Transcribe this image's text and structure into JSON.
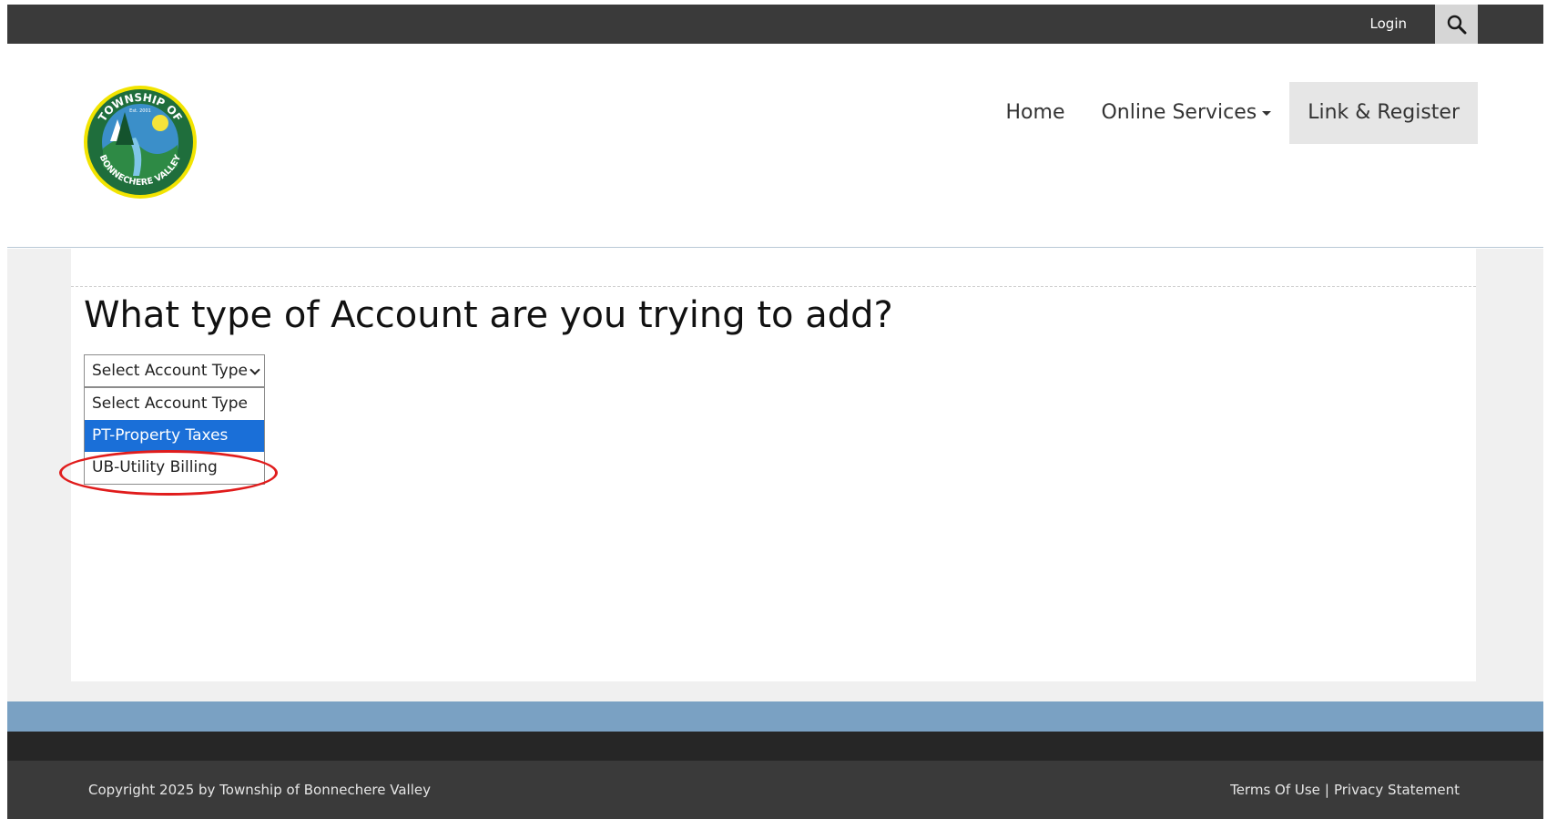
{
  "topbar": {
    "login_label": "Login",
    "search_icon": "search-icon"
  },
  "header": {
    "logo_text_top": "TOWNSHIP OF",
    "logo_text_est": "Est. 2001",
    "logo_text_bottom": "BONNECHERE VALLEY",
    "nav": {
      "home": "Home",
      "online_services": "Online Services",
      "link_register": "Link & Register"
    }
  },
  "main": {
    "heading": "What type of Account are you trying to add?",
    "select": {
      "selected": "Select Account Type",
      "options": [
        "Select Account Type",
        "PT-Property Taxes",
        "UB-Utility Billing"
      ]
    }
  },
  "footer": {
    "copyright": "Copyright 2025 by Township of Bonnechere Valley",
    "terms": "Terms Of Use",
    "separator": "|",
    "privacy": "Privacy Statement"
  },
  "colors": {
    "topbar": "#3a3a3a",
    "accent_blue": "#7aa1c3",
    "option_highlight": "#1a6fd8",
    "annotation_red": "#e01c1c"
  }
}
